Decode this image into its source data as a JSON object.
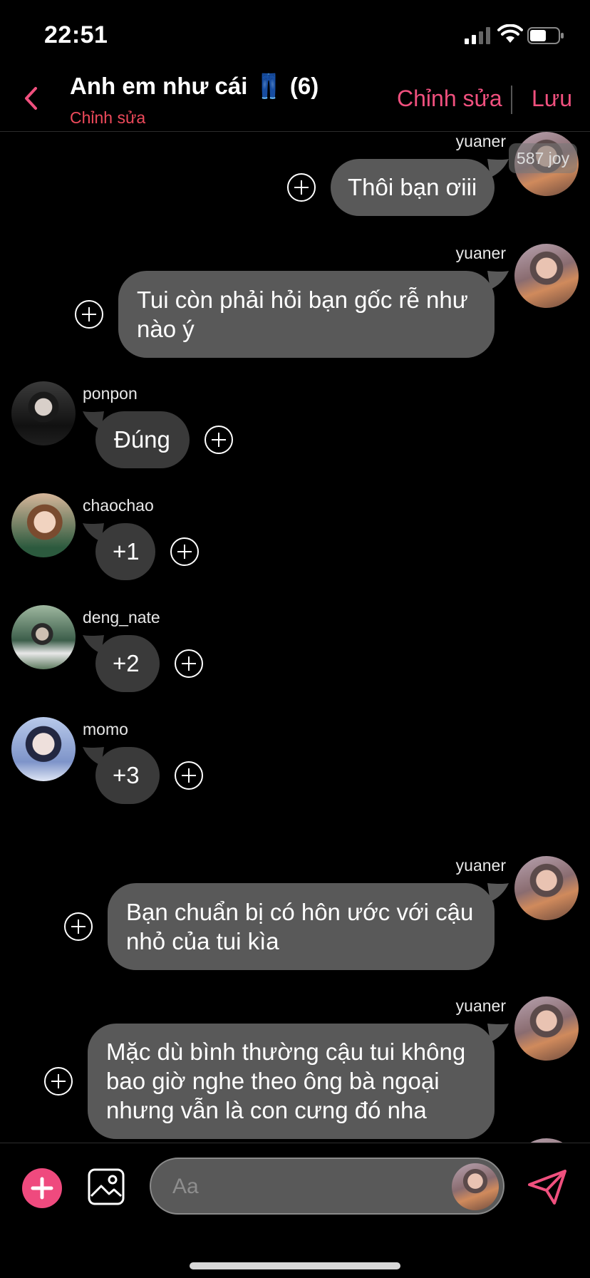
{
  "status_bar": {
    "time": "22:51"
  },
  "header": {
    "title": "Anh em như cái 👖 (6)",
    "subtitle": "Chỉnh sửa",
    "edit_label": "Chỉnh sửa",
    "save_label": "Lưu"
  },
  "badge": "587 joy",
  "messages": [
    {
      "sender": "yuaner",
      "text": "Thôi bạn ơiii",
      "direction": "outgoing"
    },
    {
      "sender": "yuaner",
      "text": "Tui còn phải hỏi bạn gốc rễ như nào ý",
      "direction": "outgoing"
    },
    {
      "sender": "ponpon",
      "text": "Đúng",
      "direction": "incoming"
    },
    {
      "sender": "chaochao",
      "text": "+1",
      "direction": "incoming"
    },
    {
      "sender": "deng_nate",
      "text": "+2",
      "direction": "incoming"
    },
    {
      "sender": "momo",
      "text": "+3",
      "direction": "incoming"
    },
    {
      "sender": "yuaner",
      "text": "Bạn chuẩn bị có hôn ước với cậu nhỏ của tui kìa",
      "direction": "outgoing"
    },
    {
      "sender": "yuaner",
      "text": "Mặc dù bình thường cậu tui không bao giờ nghe theo ông bà ngoại nhưng vẫn là con cưng đó nha",
      "direction": "outgoing"
    }
  ],
  "composer": {
    "placeholder": "Aa"
  },
  "colors": {
    "accent": "#f0507e",
    "subtitle": "#ee4a5b",
    "bubble_in": "#3a3a3a",
    "bubble_out": "#595959"
  },
  "icons": [
    "back-chevron-icon",
    "add-reaction-icon",
    "plus-circle-icon",
    "image-icon",
    "send-icon"
  ]
}
